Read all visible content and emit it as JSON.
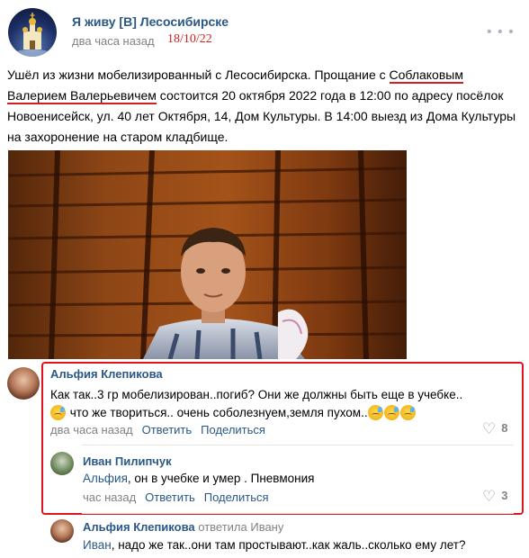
{
  "post": {
    "group_name": "Я живу [В] Лесосибирске",
    "time": "два часа назад",
    "handwritten_date": "18/10/22",
    "text_before": "Ушёл из жизни мобелизированный с Лесосибирска. Прощание с ",
    "name_part1": "Соблаковым",
    "name_part2": "Валерием Валерьевичем",
    "text_after": " состоится 20 октября 2022 года в 12:00 по адресу посёлок Новоенисейск, ул. 40 лет Октября, 14, Дом Культуры. В 14:00 выезд из Дома Культуры на захоронение на старом кладбище.",
    "more_icon": "more-dots-icon"
  },
  "comments": [
    {
      "author": "Альфия Клепикова",
      "text_line1": "Как так..3 гр мобелизирован..погиб? Они же должны быть еще в учебке..",
      "text_line2": " что же твориться.. очень соболезнуем,земля пухом..",
      "time": "два часа назад",
      "reply_label": "Ответить",
      "share_label": "Поделиться",
      "likes": "8"
    },
    {
      "author": "Иван Пилипчук",
      "addressee": "Альфия",
      "text": ", он в учебке и умер . Пневмония",
      "time": "час назад",
      "reply_label": "Ответить",
      "share_label": "Поделиться",
      "likes": "3"
    },
    {
      "author": "Альфия Клепикова",
      "replied_to": "ответила Ивану",
      "addressee": "Иван",
      "text": ", надо же так..они там простывают..как жаль..сколько ему лет?"
    }
  ],
  "colors": {
    "link": "#2a5885",
    "meta": "#828282",
    "highlight_red": "#e0141e"
  }
}
